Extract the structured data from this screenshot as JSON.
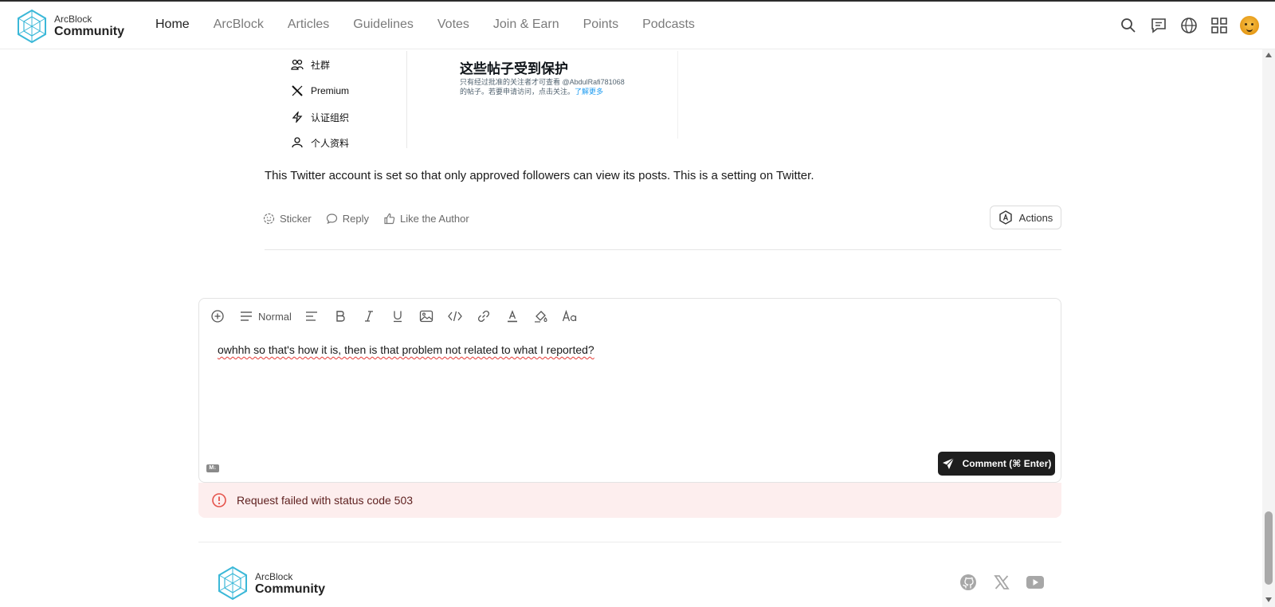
{
  "header": {
    "brand_small": "ArcBlock",
    "brand_big": "Community",
    "nav": [
      "Home",
      "ArcBlock",
      "Articles",
      "Guidelines",
      "Votes",
      "Join & Earn",
      "Points",
      "Podcasts"
    ],
    "active_nav": "Home",
    "icons": [
      "search-icon",
      "chat-icon",
      "globe-icon",
      "apps-grid-icon",
      "user-avatar"
    ]
  },
  "embedded_screenshot": {
    "sidebar": [
      {
        "icon": "people-icon",
        "label": "社群"
      },
      {
        "icon": "x-logo-icon",
        "label": "Premium"
      },
      {
        "icon": "lightning-icon",
        "label": "认证组织"
      },
      {
        "icon": "person-icon",
        "label": "个人资料"
      }
    ],
    "protected_title": "这些帖子受到保护",
    "protected_desc": "只有经过批准的关注者才可查看 @AbdulRafi781068 的帖子。若要申请访问，点击关注。",
    "learn_more": "了解更多"
  },
  "post": {
    "text": "This Twitter account is set so that only approved followers can view its posts. This is a setting on Twitter.",
    "actions": {
      "sticker": "Sticker",
      "reply": "Reply",
      "like": "Like the Author",
      "actions_button": "Actions"
    }
  },
  "editor": {
    "block_style": "Normal",
    "content": "owhhh so that's how it is, then is that problem not related to what I reported?",
    "md_badge": "M↓",
    "submit_label": "Comment (⌘ Enter)"
  },
  "error": {
    "message": "Request failed with status code 503"
  },
  "footer": {
    "brand_small": "ArcBlock",
    "brand_big": "Community",
    "social": [
      "github-icon",
      "x-icon",
      "youtube-icon"
    ]
  }
}
